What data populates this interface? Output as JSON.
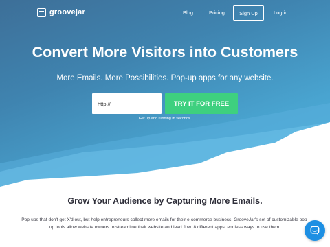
{
  "nav": {
    "logo_text": "groovejar",
    "blog": "Blog",
    "pricing": "Pricing",
    "signup": "Sign Up",
    "login": "Log in"
  },
  "hero": {
    "headline": "Convert More Visitors into Customers",
    "subheadline": "More Emails. More Possibilities. Pop-up apps for any website.",
    "url_input_value": "http://",
    "cta_label": "TRY IT FOR FREE",
    "note": "Get up and running in seconds."
  },
  "content": {
    "title": "Grow Your Audience by Capturing More Emails.",
    "body": "Pop-ups that don't get X'd out, but help entrepreneurs collect more emails for their e-commerce business. GrooveJar's set of customizable pop-up tools allow website owners to streamline their website and lead flow. 8 different apps, endless ways to use them."
  },
  "colors": {
    "hero_top": "#3d6f98",
    "hero_bottom": "#4fb4de",
    "cta": "#3ed07f",
    "chat": "#1d8fe3"
  },
  "icons": {
    "logo": "groovejar-logo-icon",
    "chat": "chat-bubble-icon"
  }
}
